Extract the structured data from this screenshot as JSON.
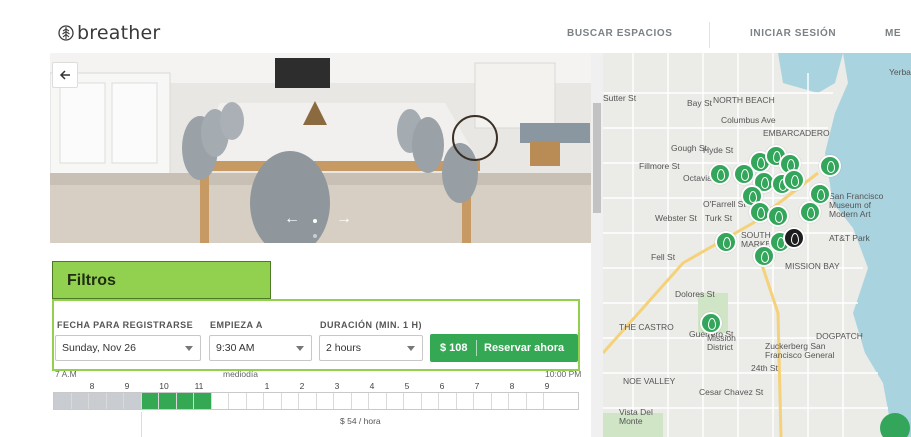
{
  "header": {
    "logo_text": "breather",
    "nav": [
      "BUSCAR ESPACIOS",
      "INICIAR SESIÓN",
      "ME"
    ]
  },
  "annotation": {
    "label": "Filtros"
  },
  "filters": {
    "date": {
      "label": "FECHA PARA REGISTRARSE",
      "value": "Sunday, Nov 26"
    },
    "start": {
      "label": "EMPIEZA A",
      "value": "9:30 AM"
    },
    "duration": {
      "label": "DURACIÓN (MIN. 1 H)",
      "value": "2 hours"
    },
    "reserve": {
      "price": "$ 108",
      "cta": "Reservar ahora"
    }
  },
  "timeline": {
    "start_label": "7 A.M",
    "mid_label": "mediodía",
    "end_label": "10:00 PM",
    "hours": [
      "8",
      "9",
      "10",
      "11",
      "1",
      "2",
      "3",
      "4",
      "5",
      "6",
      "7",
      "8",
      "9"
    ],
    "rate": "$ 54 / hora"
  },
  "map": {
    "labels": [
      "NORTH BEACH",
      "EMBARCADERO",
      "SOUTH OF MARKET",
      "MISSION BAY",
      "DOGPATCH",
      "THE CASTRO",
      "NOE VALLEY",
      "AT&T Park",
      "San Francisco Museum of Modern Art",
      "Zuckerberg San Francisco General",
      "Vista Del Monte",
      "Bay St",
      "Columbus Ave",
      "Turk St",
      "Fell St",
      "24th St",
      "Cesar Chavez St",
      "Dolores St",
      "Guerrero St",
      "Gough St",
      "Webster St",
      "Fillmore St",
      "Octavia St",
      "Hyde St",
      "O'Farrell St",
      "Yerba Buena",
      "Mission District",
      "Sutter St"
    ]
  },
  "colors": {
    "accent": "#35a853",
    "annotation_green": "#92d050",
    "map_pin": "#34a65c"
  }
}
